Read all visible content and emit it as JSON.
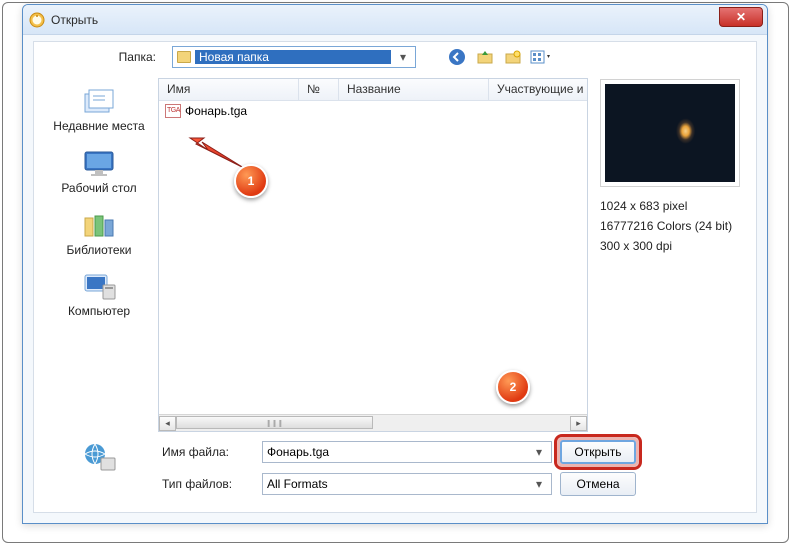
{
  "window": {
    "title": "Открыть"
  },
  "folder": {
    "label": "Папка:",
    "current": "Новая папка"
  },
  "toolbar": {
    "back_icon": "back",
    "up_icon": "up-folder",
    "new_icon": "new-folder",
    "view_icon": "view-menu"
  },
  "places": [
    {
      "label": "Недавние места"
    },
    {
      "label": "Рабочий стол"
    },
    {
      "label": "Библиотеки"
    },
    {
      "label": "Компьютер"
    }
  ],
  "columns": {
    "name": "Имя",
    "number": "№",
    "title": "Название",
    "participants": "Участвующие и"
  },
  "files": [
    {
      "name": "Фонарь.tga"
    }
  ],
  "preview": {
    "dimensions": "1024 x 683 pixel",
    "colors": "16777216 Colors (24 bit)",
    "dpi": "300 x 300 dpi"
  },
  "form": {
    "filename_label": "Имя файла:",
    "filename_value": "Фонарь.tga",
    "filetype_label": "Тип файлов:",
    "filetype_value": "All Formats",
    "open_btn": "Открыть",
    "cancel_btn": "Отмена"
  },
  "callouts": {
    "one": "1",
    "two": "2"
  }
}
